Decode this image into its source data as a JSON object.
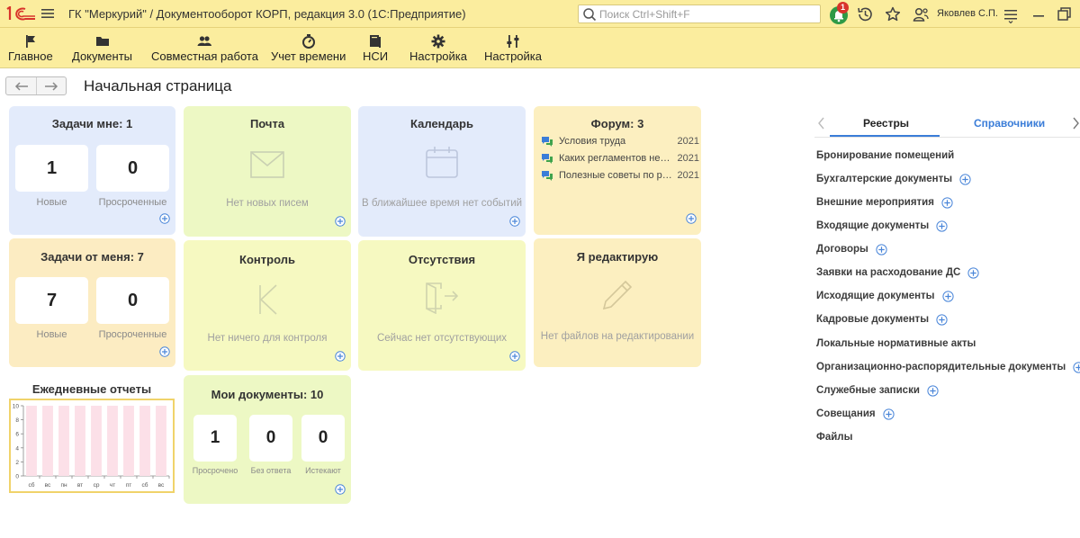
{
  "app": {
    "title": "ГК \"Меркурий\" / Документооборот КОРП, редакция 3.0  (1С:Предприятие)",
    "search_placeholder": "Поиск Ctrl+Shift+F",
    "notification_count": "1",
    "user": "Яковлев С.П.",
    "icons": [
      "1c-logo",
      "menu-icon",
      "search-icon",
      "bell-icon",
      "history-icon",
      "star-icon",
      "user-icon",
      "settings-lines-icon",
      "window-icon"
    ]
  },
  "sections": [
    {
      "label": "Главное",
      "icon": "flag-icon"
    },
    {
      "label": "Документы",
      "icon": "folder-icon"
    },
    {
      "label": "Совместная работа",
      "icon": "people-icon"
    },
    {
      "label": "Учет времени",
      "icon": "stopwatch-icon"
    },
    {
      "label": "НСИ",
      "icon": "book-icon"
    },
    {
      "label": "Настройка",
      "icon": "gear-icon"
    },
    {
      "label": "Настройка",
      "icon": "sliders-icon"
    }
  ],
  "page": {
    "title": "Начальная страница"
  },
  "tiles": {
    "tasks_to_me": {
      "title": "Задачи мне: 1",
      "new_value": "1",
      "new_label": "Новые",
      "overdue_value": "0",
      "overdue_label": "Просроченные"
    },
    "tasks_from_me": {
      "title": "Задачи от меня: 7",
      "new_value": "7",
      "new_label": "Новые",
      "overdue_value": "0",
      "overdue_label": "Просроченные"
    },
    "mail": {
      "title": "Почта",
      "empty": "Нет новых писем"
    },
    "calendar": {
      "title": "Календарь",
      "empty": "В ближайшее время нет событий"
    },
    "forum": {
      "title": "Форум: 3",
      "items": [
        {
          "text": "Условия труда",
          "year": "2021"
        },
        {
          "text": "Каких регламентов не хватает",
          "year": "2021"
        },
        {
          "text": "Полезные советы по работе",
          "year": "2021"
        }
      ]
    },
    "control": {
      "title": "Контроль",
      "empty": "Нет ничего для контроля"
    },
    "absences": {
      "title": "Отсутствия",
      "empty": "Сейчас нет отсутствующих"
    },
    "editing": {
      "title": "Я редактирую",
      "empty": "Нет файлов на редактировании"
    },
    "my_docs": {
      "title": "Мои документы: 10",
      "overdue_value": "1",
      "overdue_label": "Просрочено",
      "no_answer_value": "0",
      "no_answer_label": "Без ответа",
      "expiring_value": "0",
      "expiring_label": "Истекают"
    }
  },
  "daily_reports": {
    "title": "Ежедневные отчеты"
  },
  "chart_data": {
    "type": "bar",
    "title": "Ежедневные отчеты",
    "categories": [
      "сб",
      "вс",
      "пн",
      "вт",
      "ср",
      "чт",
      "пт",
      "сб",
      "вс"
    ],
    "values": [
      10,
      10,
      10,
      10,
      10,
      10,
      10,
      10,
      10
    ],
    "yticks": [
      "0",
      "2",
      "4",
      "6",
      "8",
      "10"
    ],
    "ylim": [
      0,
      10
    ],
    "bar_color": "#fce0e8"
  },
  "right_panel": {
    "tabs": [
      "Реестры",
      "Справочники"
    ],
    "active_tab": "Реестры",
    "items": [
      {
        "label": "Бронирование помещений",
        "plus": false
      },
      {
        "label": "Бухгалтерские документы",
        "plus": true
      },
      {
        "label": "Внешние мероприятия",
        "plus": true
      },
      {
        "label": "Входящие документы",
        "plus": true
      },
      {
        "label": "Договоры",
        "plus": true
      },
      {
        "label": "Заявки на расходование ДС",
        "plus": true
      },
      {
        "label": "Исходящие документы",
        "plus": true
      },
      {
        "label": "Кадровые документы",
        "plus": true
      },
      {
        "label": "Локальные нормативные акты",
        "plus": false
      },
      {
        "label": "Организационно-распорядительные документы",
        "plus": true
      },
      {
        "label": "Служебные записки",
        "plus": true
      },
      {
        "label": "Совещания",
        "plus": true
      },
      {
        "label": "Файлы",
        "plus": false
      }
    ]
  },
  "colors": {
    "titlebar": "#fbed9e",
    "accent_blue": "#3b7dd8",
    "plus_blue": "#4a86d9",
    "bell_green": "#2e9a46",
    "badge_red": "#d8342b"
  }
}
